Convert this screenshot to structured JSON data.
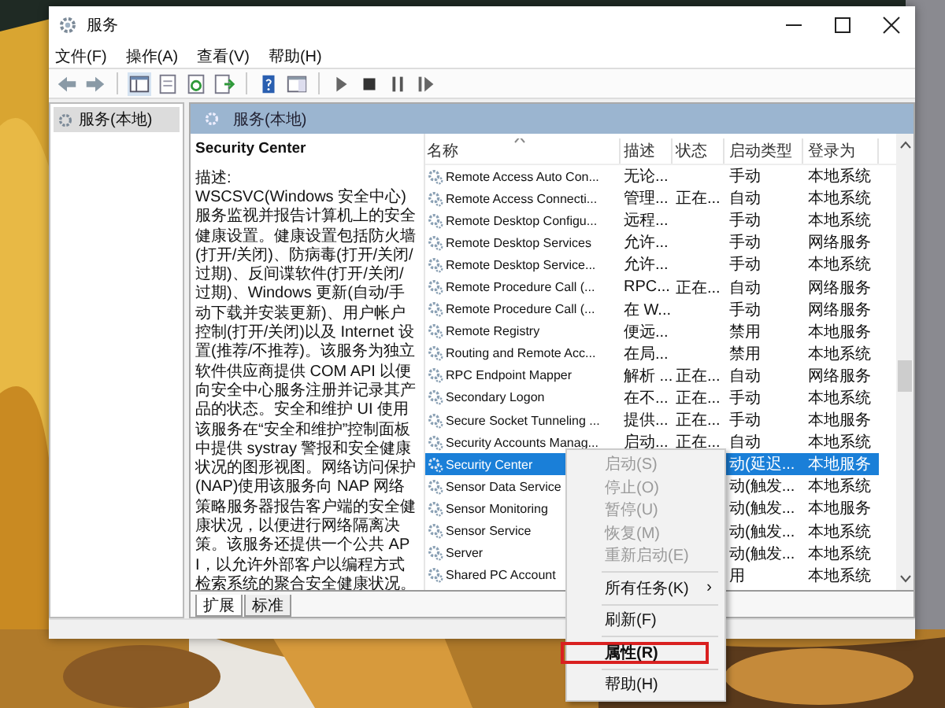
{
  "window": {
    "title": "服务"
  },
  "menu_bar": [
    "文件(F)",
    "操作(A)",
    "查看(V)",
    "帮助(H)"
  ],
  "tree": {
    "items": [
      {
        "label": "服务(本地)",
        "selected": true
      }
    ]
  },
  "panel": {
    "title": "服务(本地)"
  },
  "description": {
    "service_name": "Security Center",
    "heading": "描述:",
    "text": "WSCSVC(Windows 安全中心)服务监视并报告计算机上的安全健康设置。健康设置包括防火墙(打开/关闭)、防病毒(打开/关闭/过期)、反间谍软件(打开/关闭/过期)、Windows 更新(自动/手动下载并安装更新)、用户帐户控制(打开/关闭)以及 Internet 设置(推荐/不推荐)。该服务为独立软件供应商提供 COM API 以便向安全中心服务注册并记录其产品的状态。安全和维护 UI 使用该服务在“安全和维护”控制面板中提供 systray 警报和安全健康状况的图形视图。网络访问保护(NAP)使用该服务向 NAP 网络策略服务器报告客户端的安全健康状况，以便进行网络隔离决策。该服务还提供一个公共 API，以允许外部客户以编程方式检索系统的聚合安全健康状况。"
  },
  "table": {
    "columns": [
      "名称",
      "描述",
      "状态",
      "启动类型",
      "登录为"
    ],
    "rows": [
      {
        "name": "Remote Access Auto Con...",
        "desc": "无论...",
        "status": "",
        "startup": "手动",
        "logon": "本地系统",
        "selected": false
      },
      {
        "name": "Remote Access Connecti...",
        "desc": "管理...",
        "status": "正在...",
        "startup": "自动",
        "logon": "本地系统",
        "selected": false
      },
      {
        "name": "Remote Desktop Configu...",
        "desc": "远程...",
        "status": "",
        "startup": "手动",
        "logon": "本地系统",
        "selected": false
      },
      {
        "name": "Remote Desktop Services",
        "desc": "允许...",
        "status": "",
        "startup": "手动",
        "logon": "网络服务",
        "selected": false
      },
      {
        "name": "Remote Desktop Service...",
        "desc": "允许...",
        "status": "",
        "startup": "手动",
        "logon": "本地系统",
        "selected": false
      },
      {
        "name": "Remote Procedure Call (...",
        "desc": "RPC...",
        "status": "正在...",
        "startup": "自动",
        "logon": "网络服务",
        "selected": false
      },
      {
        "name": "Remote Procedure Call (...",
        "desc": "在 W...",
        "status": "",
        "startup": "手动",
        "logon": "网络服务",
        "selected": false
      },
      {
        "name": "Remote Registry",
        "desc": "便远...",
        "status": "",
        "startup": "禁用",
        "logon": "本地服务",
        "selected": false
      },
      {
        "name": "Routing and Remote Acc...",
        "desc": "在局...",
        "status": "",
        "startup": "禁用",
        "logon": "本地系统",
        "selected": false
      },
      {
        "name": "RPC Endpoint Mapper",
        "desc": "解析 ...",
        "status": "正在...",
        "startup": "自动",
        "logon": "网络服务",
        "selected": false
      },
      {
        "name": "Secondary Logon",
        "desc": "在不...",
        "status": "正在...",
        "startup": "手动",
        "logon": "本地系统",
        "selected": false
      },
      {
        "name": "Secure Socket Tunneling ...",
        "desc": "提供...",
        "status": "正在...",
        "startup": "手动",
        "logon": "本地服务",
        "selected": false
      },
      {
        "name": "Security Accounts Manag...",
        "desc": "启动...",
        "status": "正在...",
        "startup": "自动",
        "logon": "本地系统",
        "selected": false
      },
      {
        "name": "Security Center",
        "desc": "",
        "status": "",
        "startup": "动(延迟...",
        "logon": "本地服务",
        "selected": true
      },
      {
        "name": "Sensor Data Service",
        "desc": "",
        "status": "",
        "startup": "动(触发...",
        "logon": "本地系统",
        "selected": false
      },
      {
        "name": "Sensor Monitoring",
        "desc": "",
        "status": "",
        "startup": "动(触发...",
        "logon": "本地服务",
        "selected": false
      },
      {
        "name": "Sensor Service",
        "desc": "",
        "status": "",
        "startup": "动(触发...",
        "logon": "本地系统",
        "selected": false
      },
      {
        "name": "Server",
        "desc": "",
        "status": "",
        "startup": "动(触发...",
        "logon": "本地系统",
        "selected": false
      },
      {
        "name": "Shared PC Account",
        "desc": "",
        "status": "",
        "startup": "用",
        "logon": "本地系统",
        "selected": false
      }
    ]
  },
  "view_tabs": [
    {
      "label": "扩展",
      "selected": true
    },
    {
      "label": "标准",
      "selected": false
    }
  ],
  "context_menu": [
    {
      "kind": "item",
      "label": "启动(S)",
      "disabled": true
    },
    {
      "kind": "item",
      "label": "停止(O)",
      "disabled": true
    },
    {
      "kind": "item",
      "label": "暂停(U)",
      "disabled": true
    },
    {
      "kind": "item",
      "label": "恢复(M)",
      "disabled": true
    },
    {
      "kind": "item",
      "label": "重新启动(E)",
      "disabled": true
    },
    {
      "kind": "separator"
    },
    {
      "kind": "submenu",
      "label": "所有任务(K)",
      "arrow": "›",
      "disabled": false
    },
    {
      "kind": "separator"
    },
    {
      "kind": "item",
      "label": "刷新(F)",
      "disabled": false
    },
    {
      "kind": "separator"
    },
    {
      "kind": "item",
      "label": "属性(R)",
      "disabled": false,
      "bold": true,
      "annotated": true
    },
    {
      "kind": "separator"
    },
    {
      "kind": "item",
      "label": "帮助(H)",
      "disabled": false
    }
  ]
}
